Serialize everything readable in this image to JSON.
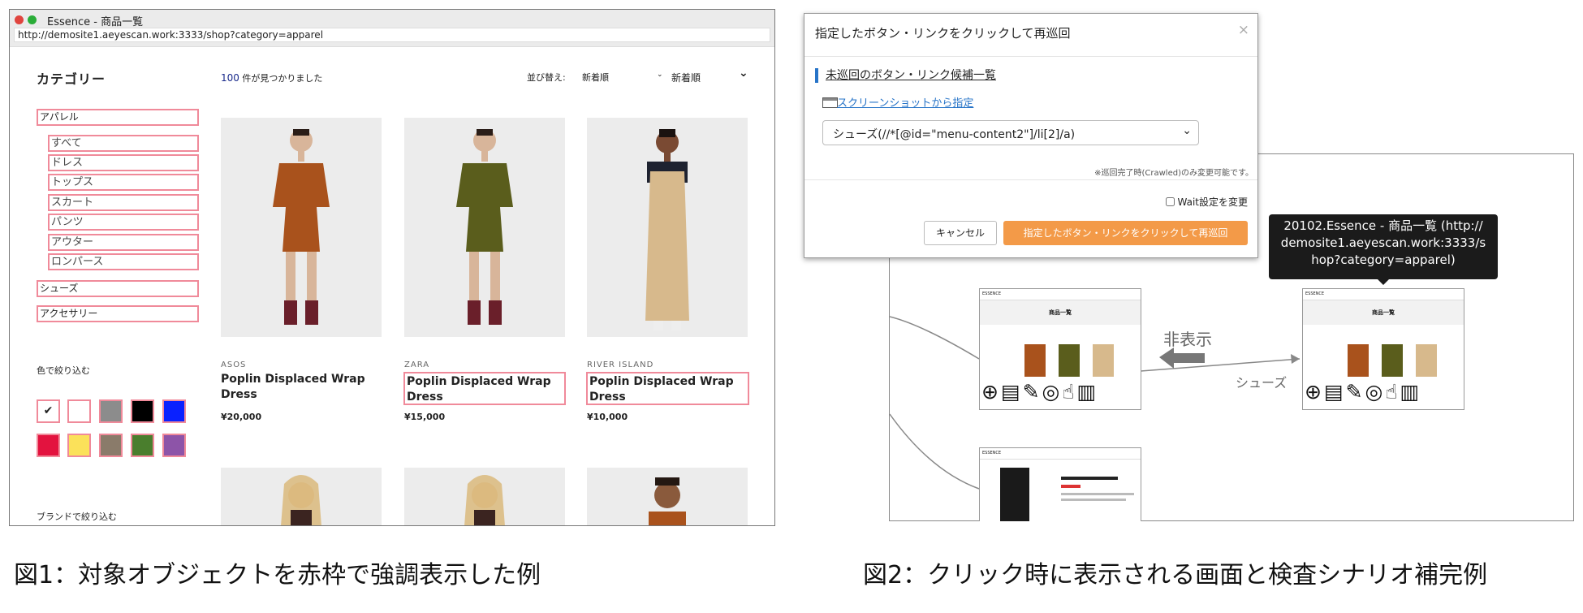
{
  "fig1": {
    "window_title": "Essence - 商品一覧",
    "url": "http://demosite1.aeyescan.work:3333/shop?category=apparel",
    "category_heading": "カテゴリー",
    "categories": [
      "アパレル",
      "すべて",
      "ドレス",
      "トップス",
      "スカート",
      "パンツ",
      "アウター",
      "ロンパース",
      "シューズ",
      "アクセサリー"
    ],
    "found_count": "100",
    "found_text": "件が見つかりました",
    "sort_label": "並び替え:",
    "sort_value": "新着順",
    "sort_value2": "新着順",
    "products": [
      {
        "brand": "ASOS",
        "name": "Poplin Displaced Wrap Dress",
        "price": "¥20,000",
        "color": "#a9521c"
      },
      {
        "brand": "ZARA",
        "name": "Poplin Displaced Wrap Dress",
        "price": "¥15,000",
        "color": "#5a5d1c"
      },
      {
        "brand": "RIVER ISLAND",
        "name": "Poplin Displaced Wrap Dress",
        "price": "¥10,000",
        "color": "#d7b98c"
      }
    ],
    "color_filter_label": "色で絞り込む",
    "swatches": [
      "#ffffff",
      "#ffffff",
      "#8c8c8c",
      "#000000",
      "#0a21ff",
      "#e3133f",
      "#fbe15a",
      "#8a7b6a",
      "#4a7e2d",
      "#8d54a8"
    ],
    "brand_filter_label": "ブランドで絞り込む",
    "caption": "図1：対象オブジェクトを赤枠で強調表示した例"
  },
  "fig2": {
    "modal_title": "指定したボタン・リンクをクリックして再巡回",
    "close": "×",
    "list_heading": "未巡回のボタン・リンク候補一覧",
    "screenshot_link": "スクリーンショットから指定",
    "select_value": "シューズ(//*[@id=\"menu-content2\"]/li[2]/a)",
    "note": "※巡回完了時(Crawled)のみ変更可能です。",
    "wait_label": "Wait設定を変更",
    "cancel_label": "キャンセル",
    "submit_label": "指定したボタン・リンクをクリックして再巡回",
    "tooltip_lines": [
      "20102.Essence - 商品一覧 (http://",
      "demosite1.aeyescan.work:3333/s",
      "hop?category=apparel)"
    ],
    "hidden_label": "非表示",
    "shoes_label": "シューズ",
    "caption": "図2：クリック時に表示される画面と検査シナリオ補完例"
  }
}
